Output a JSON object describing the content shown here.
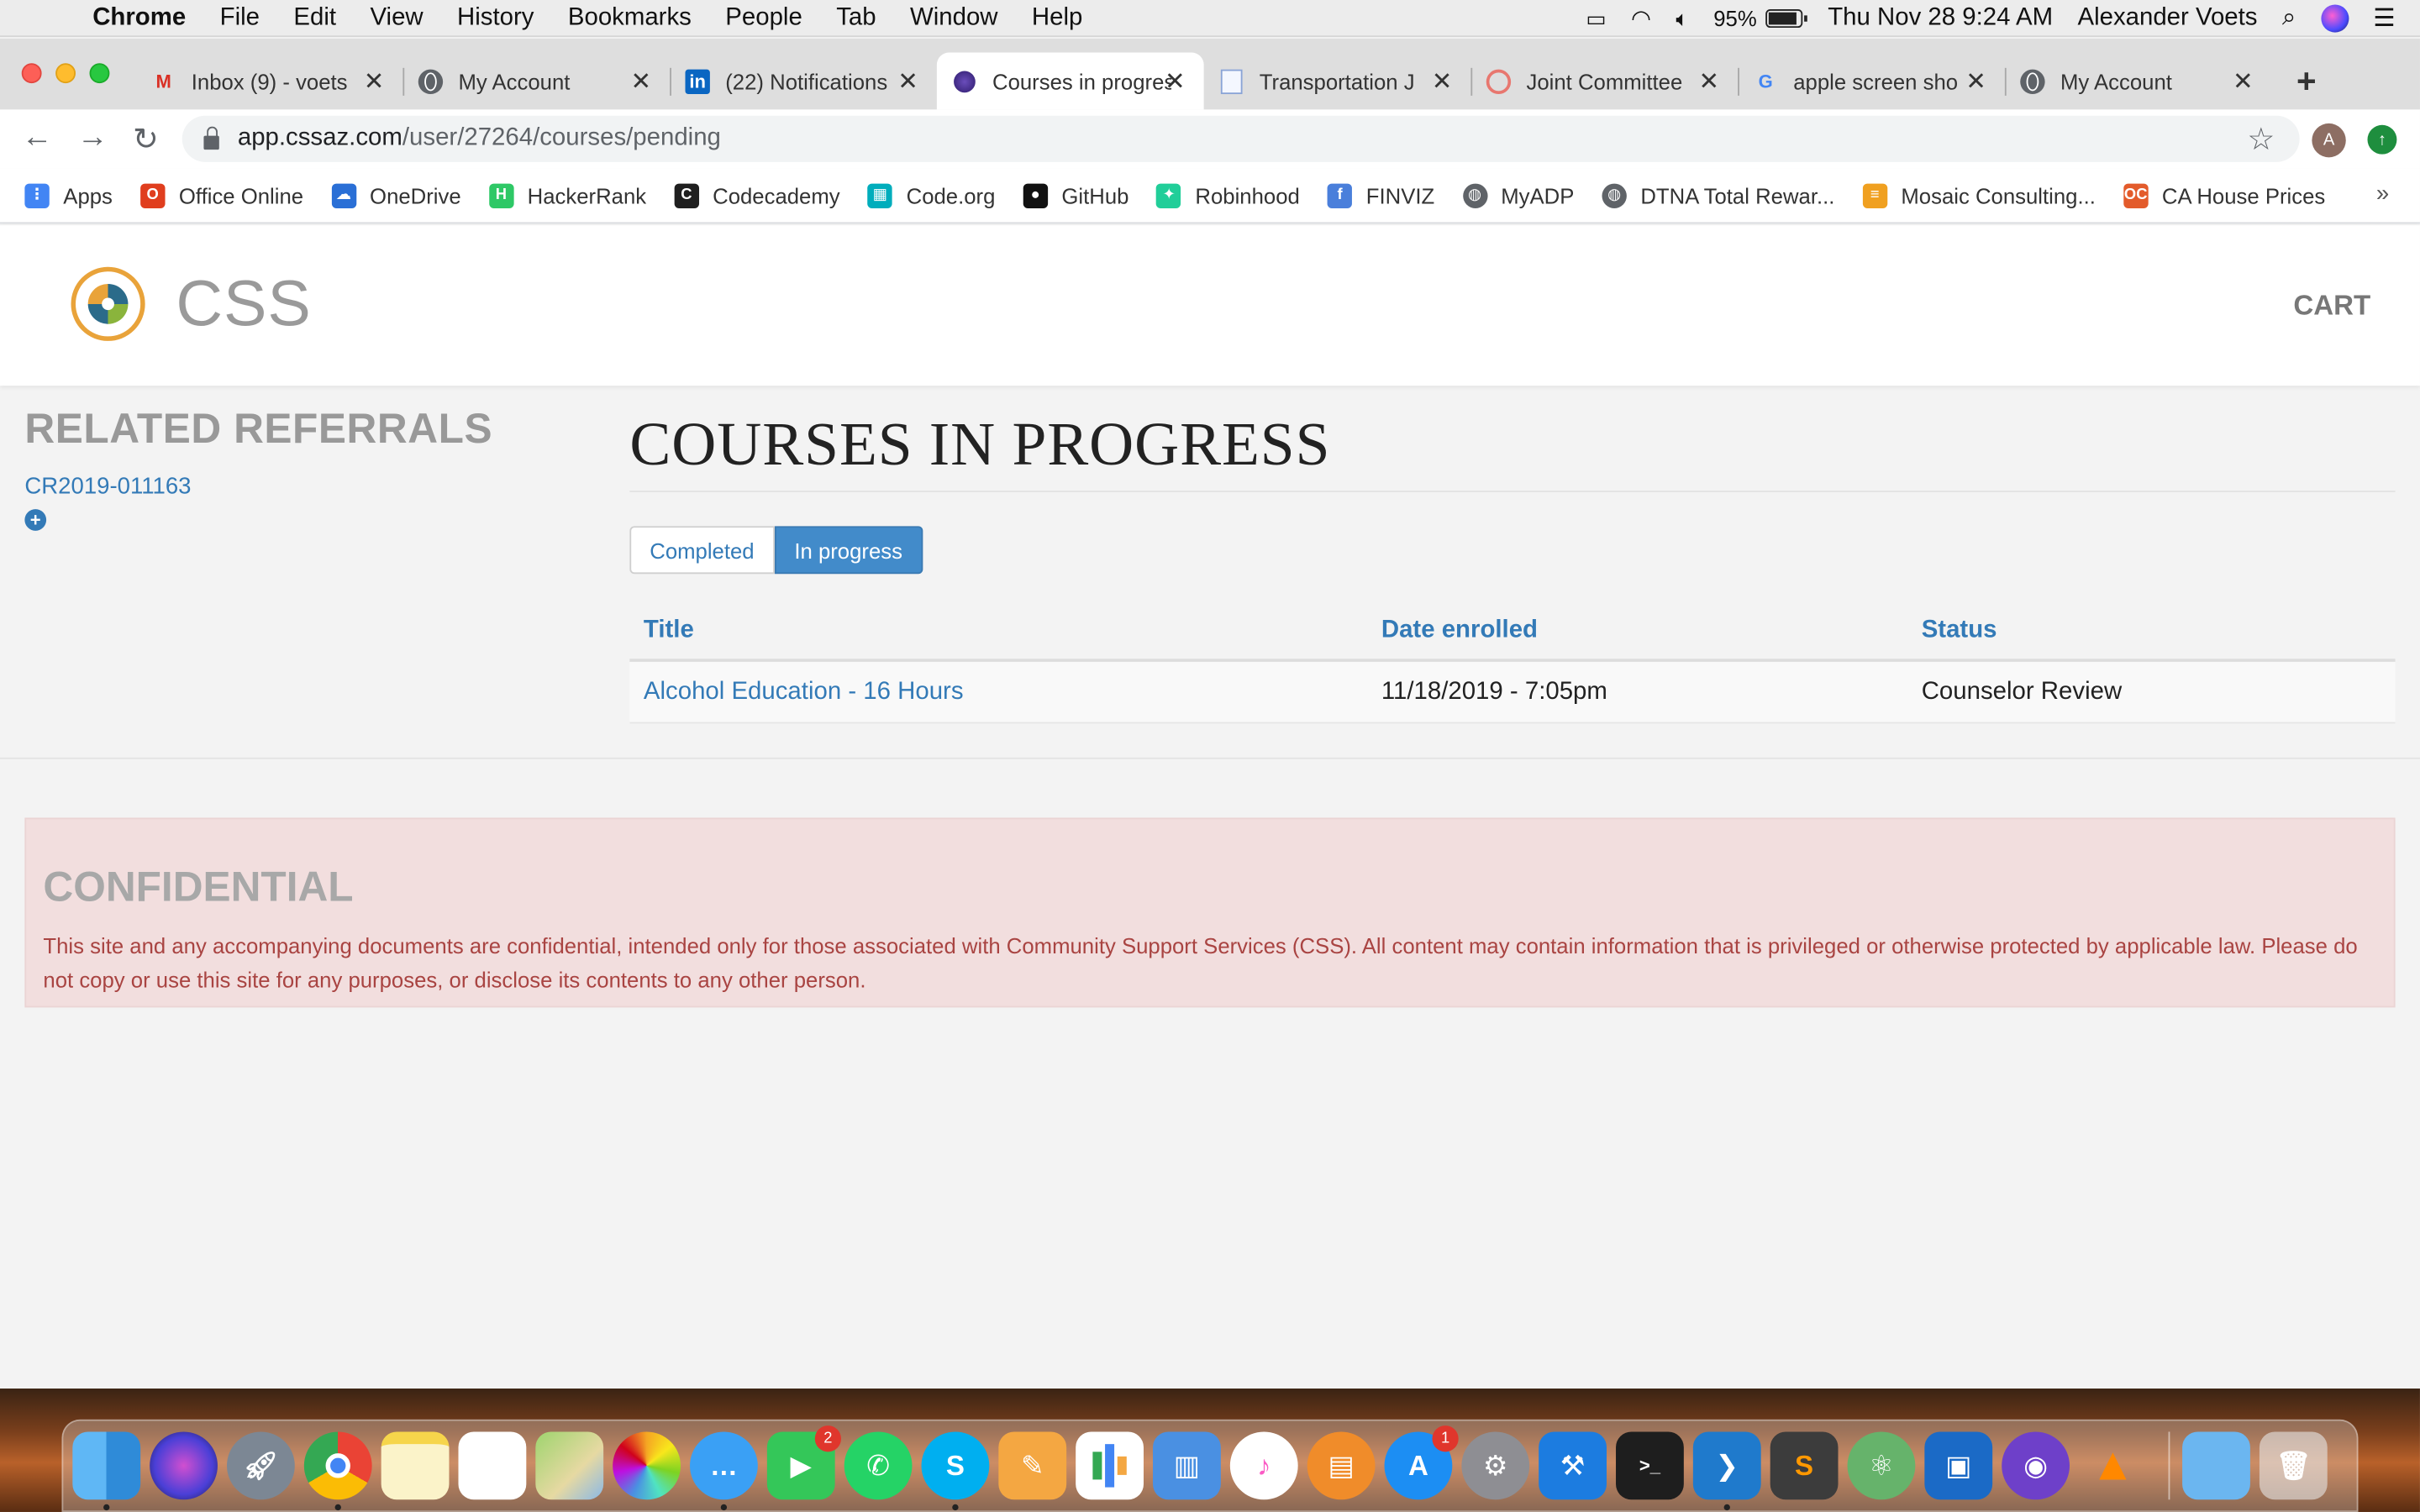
{
  "menubar": {
    "app_name": "Chrome",
    "menus": [
      "File",
      "Edit",
      "View",
      "History",
      "Bookmarks",
      "People",
      "Tab",
      "Window",
      "Help"
    ],
    "battery_percent": "95%",
    "battery_level": 0.95,
    "datetime": "Thu Nov 28  9:24 AM",
    "user": "Alexander Voets"
  },
  "tabs": [
    {
      "title": "Inbox (9) - voets",
      "icon": "gmail-icon"
    },
    {
      "title": "My Account",
      "icon": "globe-icon"
    },
    {
      "title": "(22) Notifications",
      "icon": "linkedin-icon"
    },
    {
      "title": "Courses in progress",
      "icon": "css-favicon-icon",
      "active": true
    },
    {
      "title": "Transportation J",
      "icon": "document-icon"
    },
    {
      "title": "Joint Committee",
      "icon": "google-circle-icon"
    },
    {
      "title": "apple screen sho",
      "icon": "google-icon"
    },
    {
      "title": "My Account",
      "icon": "globe-icon"
    }
  ],
  "omnibox": {
    "host": "app.cssaz.com",
    "path": "/user/27264/courses/pending"
  },
  "profile_initial": "A",
  "bookmarks": [
    {
      "label": "Apps",
      "icon": "apps-grid-icon",
      "color": "#4285f4"
    },
    {
      "label": "Office Online",
      "icon": "office-icon",
      "color": "#e03e1e"
    },
    {
      "label": "OneDrive",
      "icon": "onedrive-icon",
      "color": "#2a6fd6"
    },
    {
      "label": "HackerRank",
      "icon": "hackerrank-icon",
      "color": "#2ec866"
    },
    {
      "label": "Codecademy",
      "icon": "codecademy-icon",
      "color": "#1f1f1f"
    },
    {
      "label": "Code.org",
      "icon": "codeorg-icon",
      "color": "#00adbc"
    },
    {
      "label": "GitHub",
      "icon": "github-icon",
      "color": "#111111"
    },
    {
      "label": "Robinhood",
      "icon": "robinhood-icon",
      "color": "#21ce99"
    },
    {
      "label": "FINVIZ",
      "icon": "facebook-icon",
      "color": "#4a7fdb"
    },
    {
      "label": "MyADP",
      "icon": "globe-icon",
      "color": "#5f6368"
    },
    {
      "label": "DTNA Total Rewar...",
      "icon": "globe-icon",
      "color": "#5f6368"
    },
    {
      "label": "Mosaic Consulting...",
      "icon": "mosaic-icon",
      "color": "#f0a020"
    },
    {
      "label": "CA House Prices",
      "icon": "oc-icon",
      "color": "#e35b2b"
    }
  ],
  "site": {
    "name": "CSS",
    "cart": "CART"
  },
  "sidebar": {
    "title": "RELATED REFERRALS",
    "referral": "CR2019-011163",
    "add_symbol": "+"
  },
  "main": {
    "title": "COURSES IN PROGRESS",
    "filters": {
      "completed": "Completed",
      "in_progress": "In progress",
      "selected": "In progress"
    },
    "table": {
      "headers": [
        "Title",
        "Date enrolled",
        "Status"
      ],
      "rows": [
        {
          "title": "Alcohol Education - 16 Hours",
          "date": "11/18/2019 - 7:05pm",
          "status": "Counselor Review"
        }
      ]
    }
  },
  "notice": {
    "title": "CONFIDENTIAL",
    "text": "This site and any accompanying documents are confidential, intended only for those associated with Community Support Services (CSS). All content may contain information that is privileged or otherwise protected by applicable law. Please do not copy or use this site for any purposes, or disclose its contents to any other person."
  },
  "dock": {
    "badges": {
      "facetime": "2",
      "app_store": "1"
    }
  },
  "colors": {
    "link": "#337ab7",
    "active_filter": "#428bca",
    "notice_bg": "#f2dede",
    "notice_text": "#a94442"
  }
}
